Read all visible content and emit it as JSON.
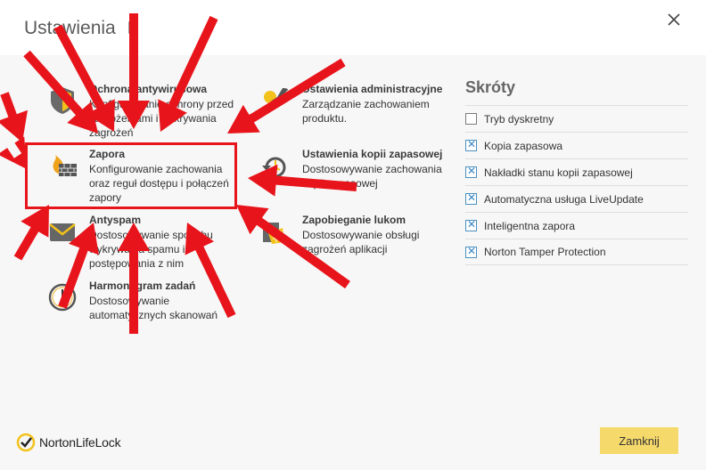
{
  "window": {
    "title": "Ustawienia",
    "close_label": "close"
  },
  "settings": [
    {
      "id": "antivirus",
      "name": "Ochrona antywirusowa",
      "desc": "Konfigurowanie ochrony przed zagrożeniami i wykrywania zagrożeń"
    },
    {
      "id": "firewall",
      "name": "Zapora",
      "desc": "Konfigurowanie zachowania oraz reguł dostępu i połączeń zapory"
    },
    {
      "id": "antispam",
      "name": "Antyspam",
      "desc": "Dostosowywanie sposobu wykrywania spamu i postępowania z nim"
    },
    {
      "id": "scheduler",
      "name": "Harmonogram zadań",
      "desc": "Dostosowywanie automatycznych skanowań"
    },
    {
      "id": "admin",
      "name": "Ustawienia administracyjne",
      "desc": "Zarządzanie zachowaniem produktu."
    },
    {
      "id": "backup",
      "name": "Ustawienia kopii zapasowej",
      "desc": "Dostosowywanie zachowania kopii zapasowej"
    },
    {
      "id": "exploit",
      "name": "Zapobieganie lukom",
      "desc": "Dostosowywanie obsługi zagrożeń aplikacji"
    }
  ],
  "shortcuts": {
    "title": "Skróty",
    "items": [
      {
        "label": "Tryb dyskretny",
        "checked": false
      },
      {
        "label": "Kopia zapasowa",
        "checked": true
      },
      {
        "label": "Nakładki stanu kopii zapasowej",
        "checked": true
      },
      {
        "label": "Automatyczna usługa LiveUpdate",
        "checked": true
      },
      {
        "label": "Inteligentna zapora",
        "checked": true
      },
      {
        "label": "Norton Tamper Protection",
        "checked": true
      }
    ]
  },
  "footer": {
    "brand": "NortonLifeLock",
    "close_button": "Zamknij"
  },
  "colors": {
    "accent_yellow": "#f6d96b",
    "highlight_red": "#e8141b",
    "check_blue": "#3a86c6"
  }
}
